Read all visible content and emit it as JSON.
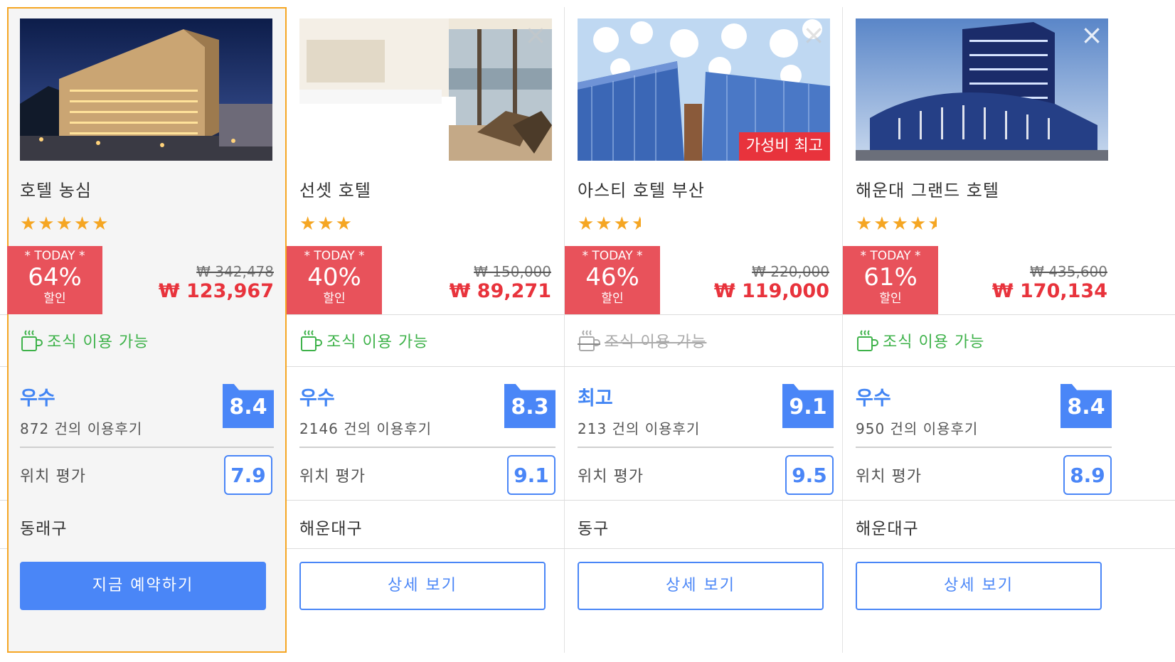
{
  "hotels": [
    {
      "name": "호텔 농심",
      "stars_full": "★★★★★",
      "stars_half": "",
      "deal": {
        "today": "* TODAY *",
        "percent": "64%",
        "label": "할인"
      },
      "old_price": "₩ 342,478",
      "new_price": "₩ 123,967",
      "breakfast": "조식 이용 가능",
      "breakfast_available": true,
      "grade": "우수",
      "reviews": "872 건의 이용후기",
      "score": "8.4",
      "location_label": "위치 평가",
      "location_score": "7.9",
      "district": "동래구",
      "button": "지금 예약하기",
      "badge": ""
    },
    {
      "name": "선셋 호텔",
      "stars_full": "★★★",
      "stars_half": "",
      "deal": {
        "today": "* TODAY *",
        "percent": "40%",
        "label": "할인"
      },
      "old_price": "₩ 150,000",
      "new_price": "₩ 89,271",
      "breakfast": "조식 이용 가능",
      "breakfast_available": true,
      "grade": "우수",
      "reviews": "2146 건의 이용후기",
      "score": "8.3",
      "location_label": "위치 평가",
      "location_score": "9.1",
      "district": "해운대구",
      "button": "상세 보기",
      "badge": ""
    },
    {
      "name": "아스티 호텔 부산",
      "stars_full": "★★★",
      "stars_half": "★",
      "deal": {
        "today": "* TODAY *",
        "percent": "46%",
        "label": "할인"
      },
      "old_price": "₩ 220,000",
      "new_price": "₩ 119,000",
      "breakfast": "조식 이용 가능",
      "breakfast_available": false,
      "grade": "최고",
      "reviews": "213 건의 이용후기",
      "score": "9.1",
      "location_label": "위치 평가",
      "location_score": "9.5",
      "district": "동구",
      "button": "상세 보기",
      "badge": "가성비 최고"
    },
    {
      "name": "해운대 그랜드 호텔",
      "stars_full": "★★★★",
      "stars_half": "★",
      "deal": {
        "today": "* TODAY *",
        "percent": "61%",
        "label": "할인"
      },
      "old_price": "₩ 435,600",
      "new_price": "₩ 170,134",
      "breakfast": "조식 이용 가능",
      "breakfast_available": true,
      "grade": "우수",
      "reviews": "950 건의 이용후기",
      "score": "8.4",
      "location_label": "위치 평가",
      "location_score": "8.9",
      "district": "해운대구",
      "button": "상세 보기",
      "badge": ""
    }
  ],
  "icons": {
    "close": "close-icon",
    "cup": "coffee-cup-icon",
    "star": "star-icon"
  },
  "colors": {
    "accent": "#4a86f7",
    "deal": "#e8525b",
    "price": "#e8333c",
    "breakfast": "#3eb24a",
    "selected_border": "#f5a623",
    "stars": "#f5a623"
  }
}
